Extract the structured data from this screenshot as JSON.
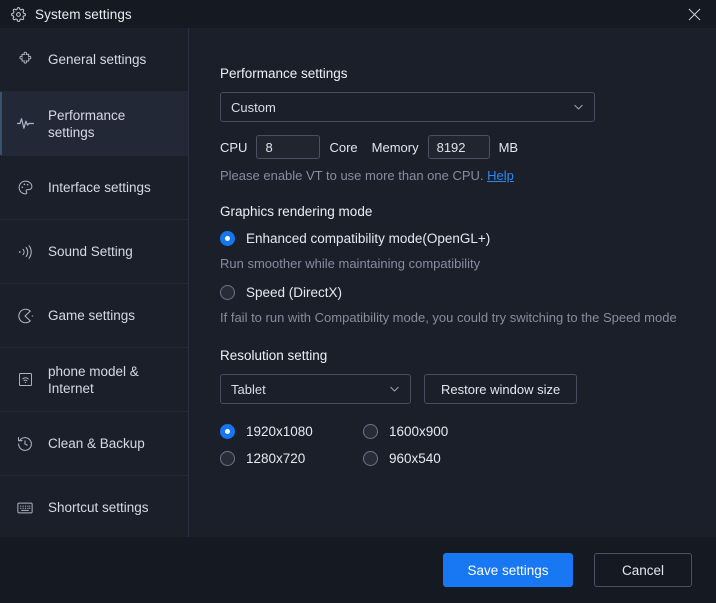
{
  "window": {
    "title": "System settings",
    "title_icon": "gear-icon",
    "close_icon": "close-icon"
  },
  "sidebar": {
    "items": [
      {
        "label": "General settings",
        "icon": "puzzle-piece-icon",
        "active": false
      },
      {
        "label": "Performance settings",
        "icon": "pulse-icon",
        "active": true
      },
      {
        "label": "Interface settings",
        "icon": "palette-icon",
        "active": false
      },
      {
        "label": "Sound Setting",
        "icon": "sound-waves-icon",
        "active": false
      },
      {
        "label": "Game settings",
        "icon": "game-pacman-icon",
        "active": false
      },
      {
        "label": "phone model & Internet",
        "icon": "wifi-box-icon",
        "active": false
      },
      {
        "label": "Clean & Backup",
        "icon": "history-clock-icon",
        "active": false
      },
      {
        "label": "Shortcut settings",
        "icon": "keyboard-icon",
        "active": false
      }
    ]
  },
  "main": {
    "performance": {
      "title": "Performance settings",
      "preset_value": "Custom",
      "cpu_label": "CPU",
      "cpu_value": "8",
      "core_label": "Core",
      "memory_label": "Memory",
      "memory_value": "8192",
      "mb_label": "MB",
      "hint_text": "Please enable VT to use more than one CPU.",
      "hint_link": "Help"
    },
    "graphics": {
      "title": "Graphics rendering mode",
      "option1_label": "Enhanced compatibility mode(OpenGL+)",
      "option1_selected": true,
      "option1_desc": "Run smoother while maintaining compatibility",
      "option2_label": "Speed (DirectX)",
      "option2_selected": false,
      "option2_desc": " If fail to run with Compatibility mode, you could try switching to the Speed mode"
    },
    "resolution": {
      "title": "Resolution setting",
      "device_value": "Tablet",
      "restore_label": "Restore window size",
      "options": [
        {
          "label": "1920x1080",
          "selected": true
        },
        {
          "label": "1600x900",
          "selected": false
        },
        {
          "label": "1280x720",
          "selected": false
        },
        {
          "label": "960x540",
          "selected": false
        }
      ]
    }
  },
  "footer": {
    "save_label": "Save settings",
    "cancel_label": "Cancel"
  },
  "colors": {
    "accent": "#1877f2",
    "link": "#2f87f2",
    "window_bg": "#151922",
    "panel_bg": "#1b1f2a",
    "active_nav": "#232837"
  }
}
